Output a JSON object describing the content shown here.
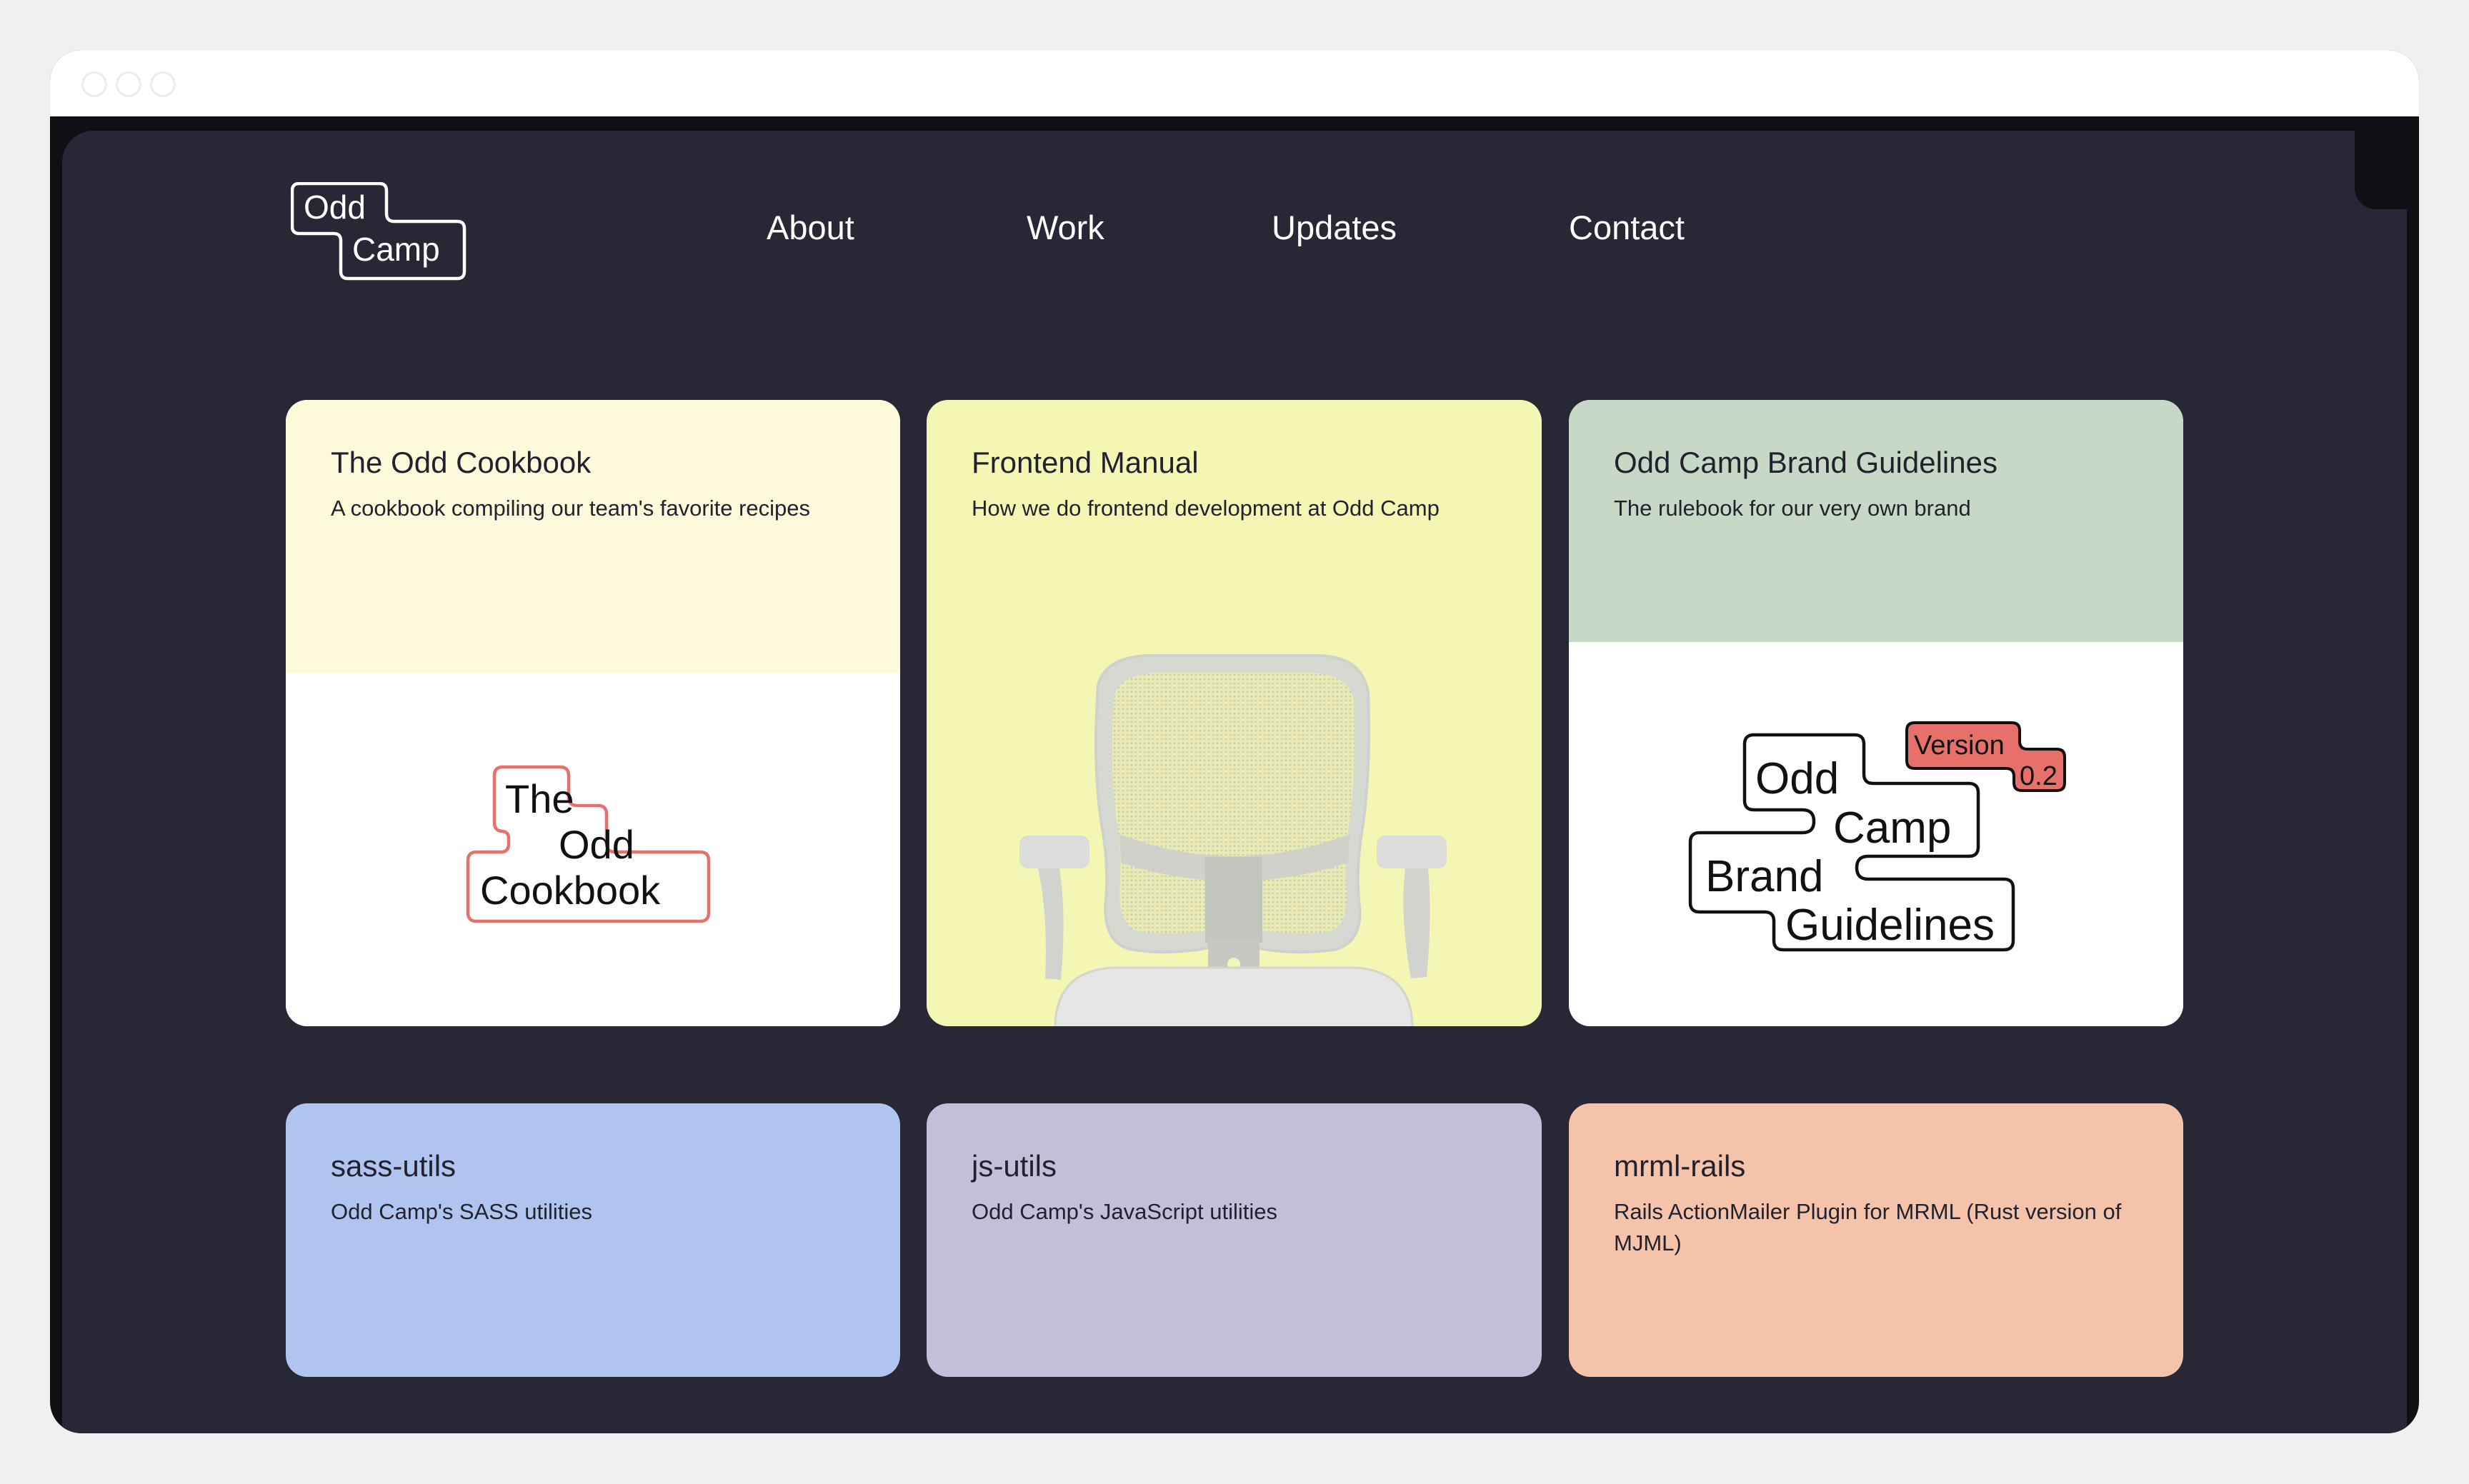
{
  "browser": {
    "window_controls": [
      "close-control",
      "minimize-control",
      "maximize-control"
    ]
  },
  "site": {
    "logo": {
      "line1": "Odd",
      "line2": "Camp"
    },
    "nav": [
      {
        "label": "About"
      },
      {
        "label": "Work"
      },
      {
        "label": "Updates"
      },
      {
        "label": "Contact"
      }
    ]
  },
  "colors": {
    "page_bg": "#f0f0f0",
    "panel_bg": "#272735",
    "text_dark": "#22222e",
    "accent_coral": "#e8706a"
  },
  "cards": [
    {
      "title": "The Odd Cookbook",
      "description": "A cookbook compiling our team's favorite recipes",
      "color": "#fdf9db",
      "media": {
        "type": "logo",
        "lines": [
          "The",
          "Odd",
          "Cookbook"
        ]
      }
    },
    {
      "title": "Frontend Manual",
      "description": "How we do frontend development at Odd Camp",
      "color": "#f4f6b3",
      "media": {
        "type": "image",
        "subject": "office-chair"
      }
    },
    {
      "title": "Odd Camp Brand Guidelines",
      "description": "The rulebook for our very own brand",
      "color": "#c7d8c7",
      "media": {
        "type": "logo",
        "lines": [
          "Odd",
          "Camp",
          "Brand",
          "Guidelines"
        ],
        "badge": [
          "Version",
          "0.2"
        ]
      }
    },
    {
      "title": "sass-utils",
      "description": "Odd Camp's SASS utilities",
      "color": "#b0c4f0"
    },
    {
      "title": "js-utils",
      "description": "Odd Camp's JavaScript utilities",
      "color": "#c4bedb"
    },
    {
      "title": "mrml-rails",
      "description": "Rails ActionMailer Plugin for MRML (Rust version of MJML)",
      "color": "#f4c3aa"
    }
  ]
}
